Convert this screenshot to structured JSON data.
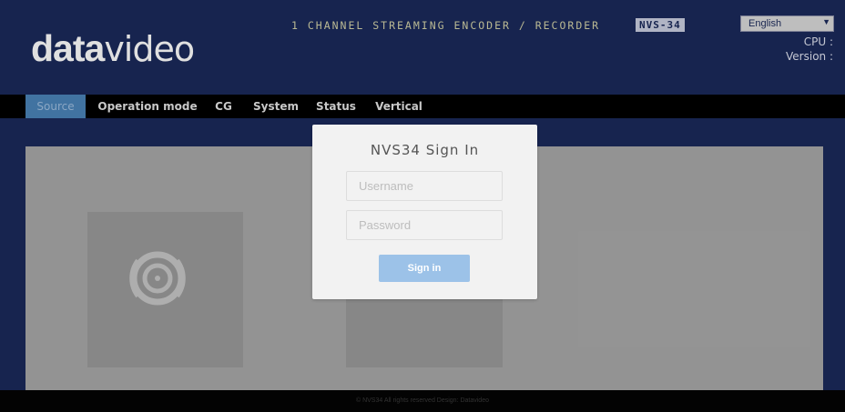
{
  "header": {
    "logo_bold": "data",
    "logo_light": "video",
    "product_title": "1 CHANNEL STREAMING ENCODER / RECORDER",
    "model_badge": "NVS-34",
    "language": "English",
    "cpu_label": "CPU :",
    "version_label": "Version :"
  },
  "nav": {
    "items": [
      {
        "label": "Source",
        "active": true
      },
      {
        "label": "Operation mode"
      },
      {
        "label": "CG"
      },
      {
        "label": "System"
      },
      {
        "label": "Status"
      },
      {
        "label": "Vertical"
      }
    ]
  },
  "login": {
    "title": "NVS34 Sign In",
    "username_placeholder": "Username",
    "password_placeholder": "Password",
    "signin_label": "Sign in"
  },
  "footer": {
    "text": "© NVS34 All rights reserved Design: Datavideo"
  },
  "colors": {
    "header_bg": "#1b2a5a",
    "nav_bg": "#000000",
    "nav_active": "#4a83b8",
    "signin_button": "#9cc2e8"
  }
}
